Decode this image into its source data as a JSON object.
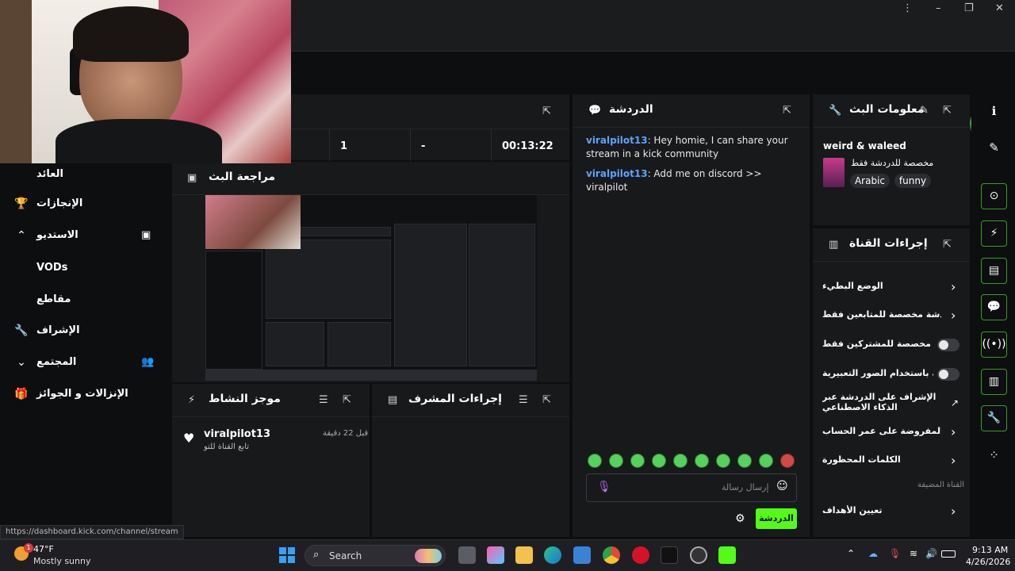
{
  "window": {
    "menu_icon": "⋮",
    "minimize": "–",
    "maximize": "❐",
    "close": "✕"
  },
  "left_nav": {
    "items": [
      {
        "label": "العائد",
        "icon": "dollar-icon"
      },
      {
        "label": "الإنجازات",
        "icon": "trophy-icon",
        "glyph": "🏆"
      },
      {
        "label": "الاستديو",
        "icon": "chevron-up-icon",
        "glyph": "⌃",
        "right_glyph": "▣"
      },
      {
        "label": "VODs"
      },
      {
        "label": "مقاطع"
      },
      {
        "label": "الإشراف",
        "icon": "wrench-icon",
        "glyph": "🔧"
      },
      {
        "label": "المجتمع",
        "icon": "chevron-down-icon",
        "glyph": "⌄",
        "right_glyph": "👥"
      },
      {
        "label": "الإنزالات و الجوائز",
        "icon": "gift-icon",
        "glyph": "🎁"
      }
    ]
  },
  "stats": {
    "v1": "1",
    "v2": "-",
    "v3": "00:13:22"
  },
  "stream_review": {
    "title": "مراجعة البث"
  },
  "activity": {
    "title": "موجز النشاط",
    "user": "viralpilot13",
    "time": "قبل 22 دقيقة",
    "desc": "تابع القناة للتو"
  },
  "mod_actions": {
    "title": "إجراءات المشرف"
  },
  "chat": {
    "title": "الدردشة",
    "messages": [
      {
        "user": "viralpilot13",
        "text": ": Hey homie, I can share your stream in a kick community"
      },
      {
        "user": "viralpilot13",
        "text": ": Add me on discord >> viralpilot"
      }
    ],
    "input_placeholder": "إرسال رسالة",
    "send_label": "الدردشة"
  },
  "stream_info": {
    "title": "معلومات البث",
    "stream_title": "weird & waleed",
    "category": "مخصصة للدردشة فقط",
    "tags": [
      "Arabic",
      "funny"
    ]
  },
  "channel_actions": {
    "title": "إجراءات القناة",
    "rows": [
      {
        "label": "الوضع البطيء",
        "kind": "chevron"
      },
      {
        "label": "دردشة مخصصة للمتابعين فقط",
        "kind": "chevron"
      },
      {
        "label": "الدردشة مخصصة للمشتركين فقط",
        "kind": "toggle"
      },
      {
        "label": "الدردشة باستخدام الصور التعبيرية...",
        "kind": "toggle"
      },
      {
        "label": "الإشراف على الدردشة عبر الذكاء الاصطناعي",
        "kind": "external"
      },
      {
        "label": "القيود المفروضة على عمر الحساب",
        "kind": "chevron"
      },
      {
        "label": "الكلمات المحظورة",
        "kind": "chevron"
      }
    ],
    "section_label": "القناة المضيفة",
    "goals_label": "تعيين الأهداف"
  },
  "status_url": "https://dashboard.kick.com/channel/stream",
  "taskbar": {
    "weather_temp": "47°F",
    "weather_desc": "Mostly sunny",
    "weather_badge": "1",
    "search_label": "Search",
    "time": "9:13 AM",
    "date": "4/26/2026"
  },
  "colors": {
    "accent": "#53fc18",
    "link": "#5aa4ff",
    "panel": "#18191b",
    "bg": "#0d0e0f"
  }
}
